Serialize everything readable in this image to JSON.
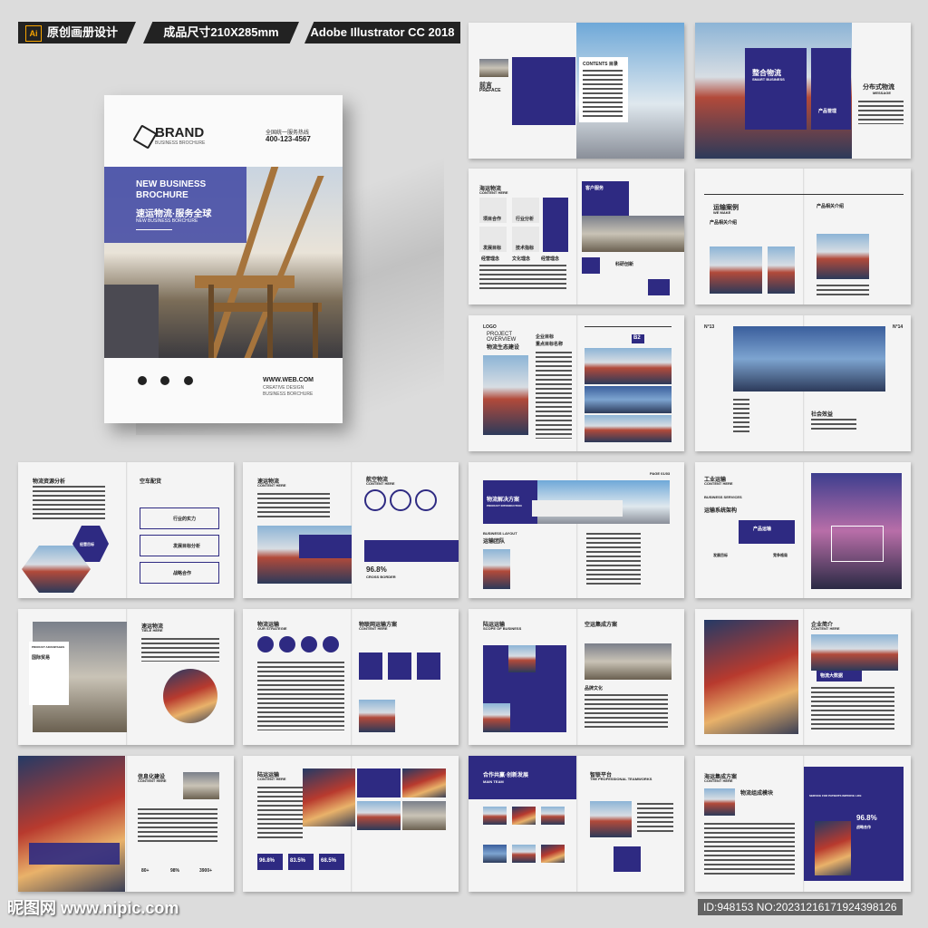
{
  "header": {
    "tag1": "原创画册设计",
    "ai_icon": "Ai",
    "tag2": "成品尺寸210X285mm",
    "tag3": "Adobe Illustrator CC 2018"
  },
  "cover": {
    "brand": "BRAND",
    "brand_sub": "BUSINESS BROCHURE",
    "hotline_label": "全国统一服务热线",
    "hotline": "400-123-4567",
    "title_line1": "NEW BUSINESS",
    "title_line2": "BROCHURE",
    "slogan": "速运物流·服务全球",
    "slogan_sub": "NEW BUSINESS BORCHURE",
    "website": "WWW.WEB.COM",
    "creative": "CREATIVE DESIGN",
    "business": "BUSINESS BORCHURE",
    "icons": [
      "phone-icon",
      "mail-icon",
      "wechat-icon"
    ]
  },
  "spreads": {
    "s1": {
      "left_title": "前言",
      "left_sub": "PREFACE",
      "contents": "CONTENTS 目录"
    },
    "s2": {
      "title": "整合物流",
      "title_sub": "SMART BUSINESS",
      "right_title": "分布式物流",
      "right_sub": "MESSAGE",
      "btn": "产品管理"
    },
    "s3": {
      "title": "海运物流",
      "title_sub": "CONTENT HERE",
      "tag": "客户服务",
      "i1": "项目合作",
      "i2": "行业分析",
      "i3": "发展目标",
      "i4": "技术指标",
      "i5": "经营理念",
      "i6": "文化理念",
      "i7": "经营理念",
      "i8": "科研创新"
    },
    "s4": {
      "title": "运输案例",
      "title_sub": "WE MAKE",
      "sub": "产品相关介绍",
      "right": "产品相关介绍"
    },
    "s5": {
      "logo": "LOGO",
      "title1": "PROJECT",
      "title2": "OVERVIEW",
      "title3": "物流生态建设",
      "sub": "企业目标",
      "sub2": "重点目标名称",
      "num": "B2"
    },
    "s6": {
      "n1": "N°13",
      "n2": "N°14",
      "right": "社会效益"
    },
    "s7": {
      "title": "物流资源分析",
      "right": "空车配货",
      "r1": "行业的实力",
      "r2": "发展目标分析",
      "r3": "战略合作",
      "hex": "经营目标"
    },
    "s8": {
      "title": "速运物流",
      "sub": "CONTENT HERE",
      "right": "航空物流",
      "right_sub": "CONTENT HERE",
      "stat": "96.8%",
      "stat_sub": "CROSS BORDER"
    },
    "s9": {
      "title": "物流解决方案",
      "sub": "PRODUCT INTRODUCTION",
      "layout": "BUSINESS LAYOUT",
      "team": "运输团队",
      "page": "PAGE 01/03"
    },
    "s10": {
      "title": "工业运输",
      "sub": "CONTENT HERE",
      "biz": "BUSINESS SERVICES",
      "sys": "运输系统架构",
      "btn": "产品运输",
      "i1": "发展目标",
      "i2": "竞争格局"
    },
    "s11": {
      "tag": "PRODUCT ADVANTAGES",
      "title": "国际贸易",
      "right": "速运物流",
      "right_sub": "TIELE HERE"
    },
    "s12": {
      "title": "物流运输",
      "sub": "OUR STRATEGIE",
      "right": "物联网运输方案",
      "right_sub": "CONTENT HERE"
    },
    "s13": {
      "title": "陆运运输",
      "sub": "SCOPE OF BUSINESS",
      "right": "空运集成方案",
      "culture": "品牌文化"
    },
    "s14": {
      "title": "企业简介",
      "sub": "CONTENT HERE",
      "tag": "物流大数据"
    },
    "s15": {
      "title": "信息化建设",
      "sub": "CONTENT HERE",
      "v1": "80+",
      "v2": "98%",
      "v3": "3900+"
    },
    "s16": {
      "title": "陆运运输",
      "sub": "CONTENT HERE",
      "p1": "96.8%",
      "p2": "83.5%",
      "p3": "68.5%"
    },
    "s17": {
      "title": "合作共赢·创新发展",
      "sub": "MAIN TEAM",
      "right": "智联平台",
      "right_sub": "THE PROFESSIONAL TEAMWORKS"
    },
    "s18": {
      "title": "海运集成方案",
      "sub": "CONTENT HERE",
      "mod": "物流组成模块",
      "stat": "96.8%",
      "stat_sub": "战略合作",
      "svc": "SERVICE FOR PATIENTS IMPROVE LIFE"
    }
  },
  "footer": {
    "watermark": "昵图网 www.nipic.com",
    "id": "ID:948153 NO:20231216171924398126"
  },
  "colors": {
    "navy": "#2e2a82",
    "accent": "#3840a0",
    "bg": "#dcdcdc"
  }
}
